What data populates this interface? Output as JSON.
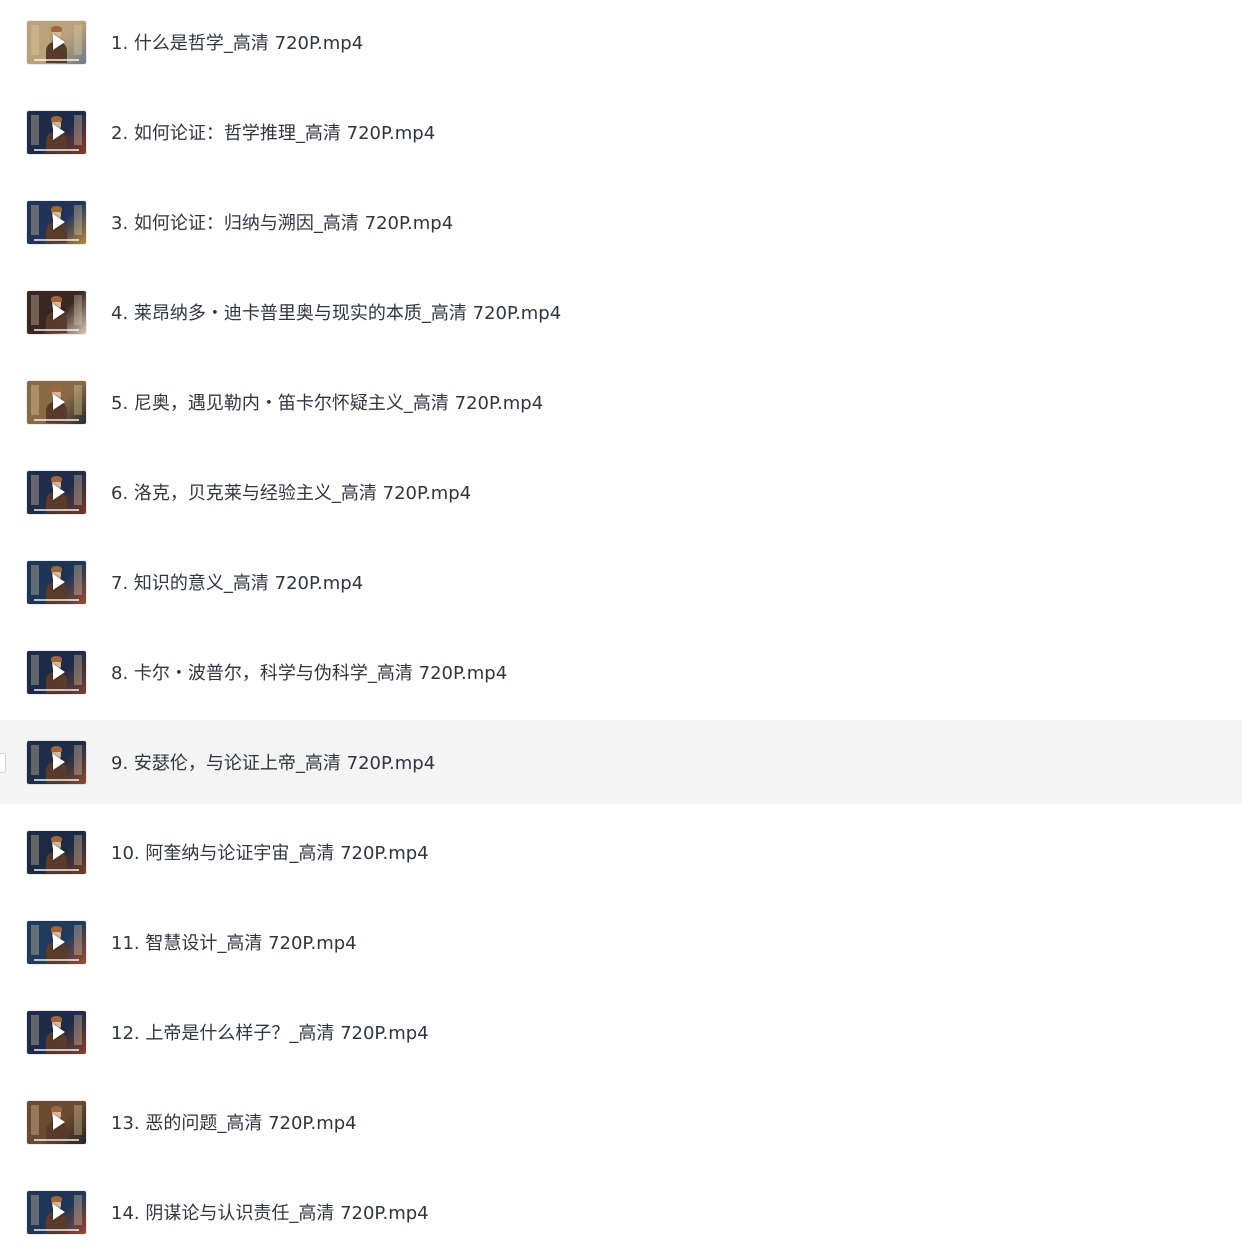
{
  "files": [
    {
      "name": "1. 什么是哲学_高清 720P.mp4",
      "thumb_colors": [
        "#b9a27a",
        "#6d7a86"
      ],
      "selected": false
    },
    {
      "name": "2. 如何论证：哲学推理_高清 720P.mp4",
      "thumb_colors": [
        "#1e2c4a",
        "#8a3b2a"
      ],
      "selected": false
    },
    {
      "name": "3. 如何论证：归纳与溯因_高清 720P.mp4",
      "thumb_colors": [
        "#22335a",
        "#b38a3a"
      ],
      "selected": false
    },
    {
      "name": "4. 莱昂纳多・迪卡普里奥与现实的本质_高清 720P.mp4",
      "thumb_colors": [
        "#3a2622",
        "#d8c7b7"
      ],
      "selected": false
    },
    {
      "name": "5. 尼奥，遇见勒内・笛卡尔怀疑主义_高清 720P.mp4",
      "thumb_colors": [
        "#8a6a45",
        "#2a2a2a"
      ],
      "selected": false
    },
    {
      "name": "6. 洛克，贝克莱与经验主义_高清 720P.mp4",
      "thumb_colors": [
        "#1f2d4a",
        "#7a3a2a"
      ],
      "selected": false
    },
    {
      "name": "7. 知识的意义_高清 720P.mp4",
      "thumb_colors": [
        "#1d3556",
        "#9a4a30"
      ],
      "selected": false
    },
    {
      "name": "8. 卡尔・波普尔，科学与伪科学_高清 720P.mp4",
      "thumb_colors": [
        "#1c2b47",
        "#7c3f2d"
      ],
      "selected": false
    },
    {
      "name": "9. 安瑟伦，与论证上帝_高清 720P.mp4",
      "thumb_colors": [
        "#1e2d48",
        "#8a4a2e"
      ],
      "selected": true
    },
    {
      "name": "10. 阿奎纳与论证宇宙_高清 720P.mp4",
      "thumb_colors": [
        "#1c2a44",
        "#7a3c2a"
      ],
      "selected": false
    },
    {
      "name": "11. 智慧设计_高清 720P.mp4",
      "thumb_colors": [
        "#1f3a5c",
        "#a04a2c"
      ],
      "selected": false
    },
    {
      "name": "12. 上帝是什么样子？_高清 720P.mp4",
      "thumb_colors": [
        "#1d2c48",
        "#8a3e2c"
      ],
      "selected": false
    },
    {
      "name": "13. 恶的问题_高清 720P.mp4",
      "thumb_colors": [
        "#6a4a30",
        "#2a2420"
      ],
      "selected": false
    },
    {
      "name": "14. 阴谋论与认识责任_高清 720P.mp4",
      "thumb_colors": [
        "#1e3658",
        "#9a4630"
      ],
      "selected": false
    }
  ]
}
